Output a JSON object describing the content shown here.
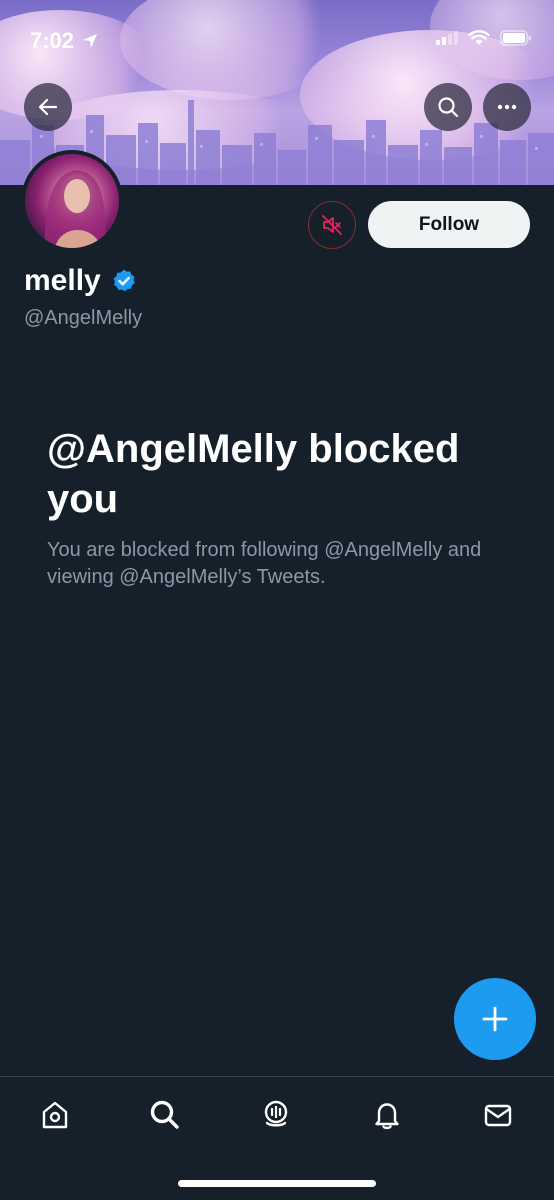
{
  "status_bar": {
    "time": "7:02"
  },
  "profile": {
    "display_name": "melly",
    "handle": "@AngelMelly",
    "follow_label": "Follow"
  },
  "blocked": {
    "title": "@AngelMelly blocked you",
    "description": "You are blocked from following @AngelMelly and viewing @AngelMelly’s Tweets."
  },
  "icons": {
    "back": "arrow-left-icon",
    "search": "search-icon",
    "more": "more-icon",
    "mute": "muted-speaker-icon",
    "verified": "verified-badge-icon",
    "compose": "plus-icon",
    "tabs": [
      "home-icon",
      "explore-search-icon",
      "spaces-icon",
      "notifications-bell-icon",
      "messages-envelope-icon"
    ]
  },
  "colors": {
    "background": "#15202b",
    "accent": "#1d9bf0",
    "secondary_text": "#8b98a5",
    "mute_red": "#e0245e"
  }
}
